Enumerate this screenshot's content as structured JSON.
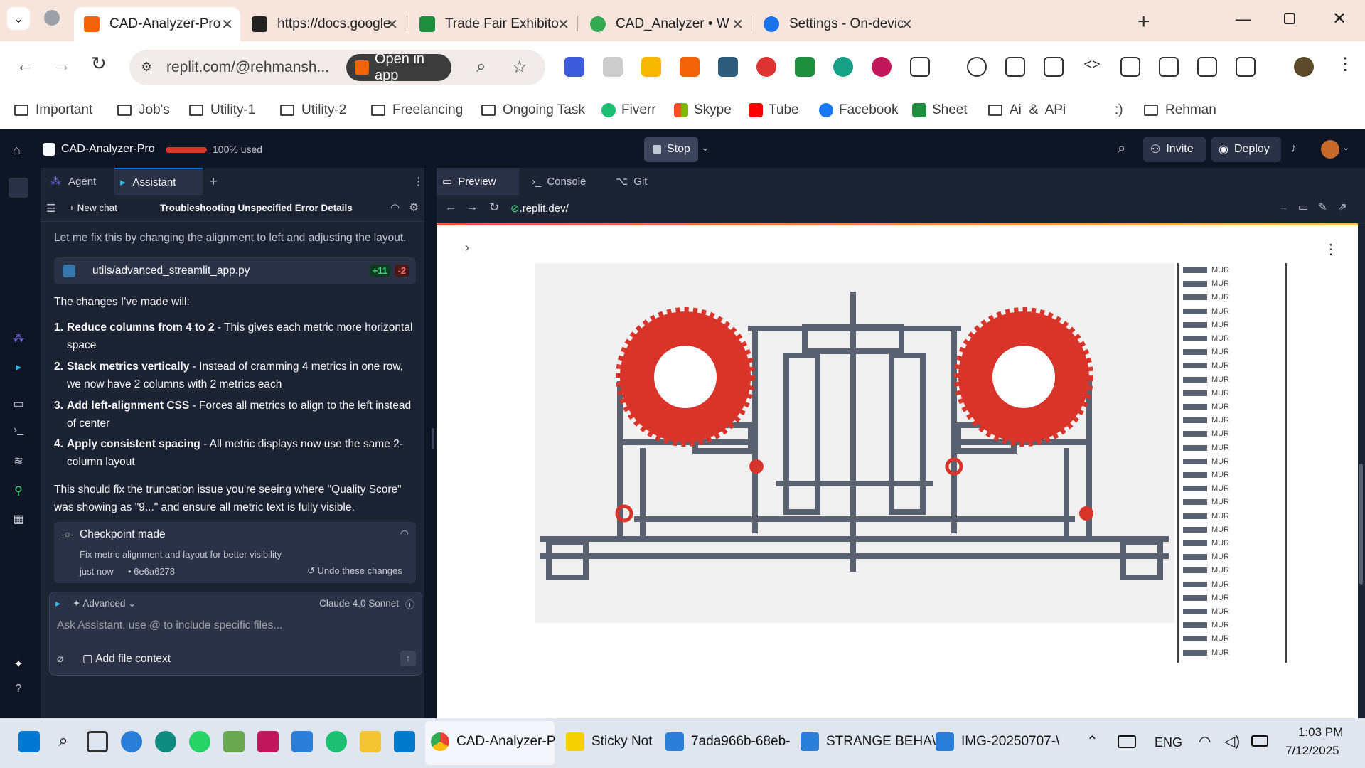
{
  "browser": {
    "tabs": [
      {
        "title": "CAD-Analyzer-Pro - Re"
      },
      {
        "title": "https://docs.google.con"
      },
      {
        "title": "Trade Fair Exhibitor Dat"
      },
      {
        "title": "CAD_Analyzer • Web S"
      },
      {
        "title": "Settings - On-device sit"
      }
    ],
    "new_tab": "+",
    "url": "replit.com/@rehmansh...",
    "open_in_app": "Open in app",
    "bookmarks": [
      "Important",
      "Job's",
      "Utility-1",
      "Utility-2",
      "Freelancing",
      "Ongoing Task",
      "Fiverr",
      "Skype",
      "Tube",
      "Facebook",
      "Sheet",
      "Ai  &  APi",
      ":)",
      "Rehman"
    ]
  },
  "replit": {
    "project": "CAD-Analyzer-Pro",
    "usage": "100% used",
    "stop": "Stop",
    "invite": "Invite",
    "deploy": "Deploy"
  },
  "left_pane": {
    "tabs": [
      "Agent",
      "Assistant"
    ],
    "add_tab": "+",
    "new_chat": "New chat",
    "chat_title": "Troubleshooting Unspecified Error Details",
    "intro": "Let me fix this by changing the alignment to left and adjusting the layout.",
    "file": {
      "name": "utils/advanced_streamlit_app.py",
      "added": "+11",
      "removed": "-2"
    },
    "changes_header": "The changes I've made will:",
    "changes": [
      {
        "num": "1.",
        "bold": "Reduce columns from 4 to 2",
        "text": " - This gives each metric more horizontal space"
      },
      {
        "num": "2.",
        "bold": "Stack metrics vertically",
        "text": " - Instead of cramming 4 metrics in one row, we now have 2 columns with 2 metrics each"
      },
      {
        "num": "3.",
        "bold": "Add left-alignment CSS",
        "text": " - Forces all metrics to align to the left instead of center"
      },
      {
        "num": "4.",
        "bold": "Apply consistent spacing",
        "text": " - All metric displays now use the same 2-column layout"
      }
    ],
    "summary": "This should fix the truncation issue you're seeing where \"Quality Score\" was showing as \"9...\" and ensure all metric text is fully visible.",
    "checkpoint": {
      "title": "Checkpoint made",
      "desc": "Fix metric alignment and layout for better visibility",
      "time": "just now",
      "hash": "• 6e6a6278",
      "undo": "Undo these changes"
    },
    "input": {
      "advanced": "Advanced",
      "model": "Claude 4.0 Sonnet",
      "placeholder": "Ask Assistant, use @ to include specific files...",
      "add_context": "Add file context"
    }
  },
  "right_pane": {
    "tabs": [
      "Preview",
      "Console",
      "Git"
    ],
    "url": ".replit.dev/",
    "legend_label": "MUR",
    "legend_count": 29
  },
  "taskbar": {
    "apps": [
      "CAD-Analyzer-P",
      "Sticky Not",
      "7ada966b-68eb-",
      "STRANGE BEHA\\",
      "IMG-20250707-\\"
    ],
    "lang": "ENG",
    "time": "1:03 PM",
    "date": "7/12/2025"
  },
  "colors": {
    "accent_red": "#d8342a",
    "cad_gray": "#5a6272",
    "replit_bg": "#0e1525"
  }
}
